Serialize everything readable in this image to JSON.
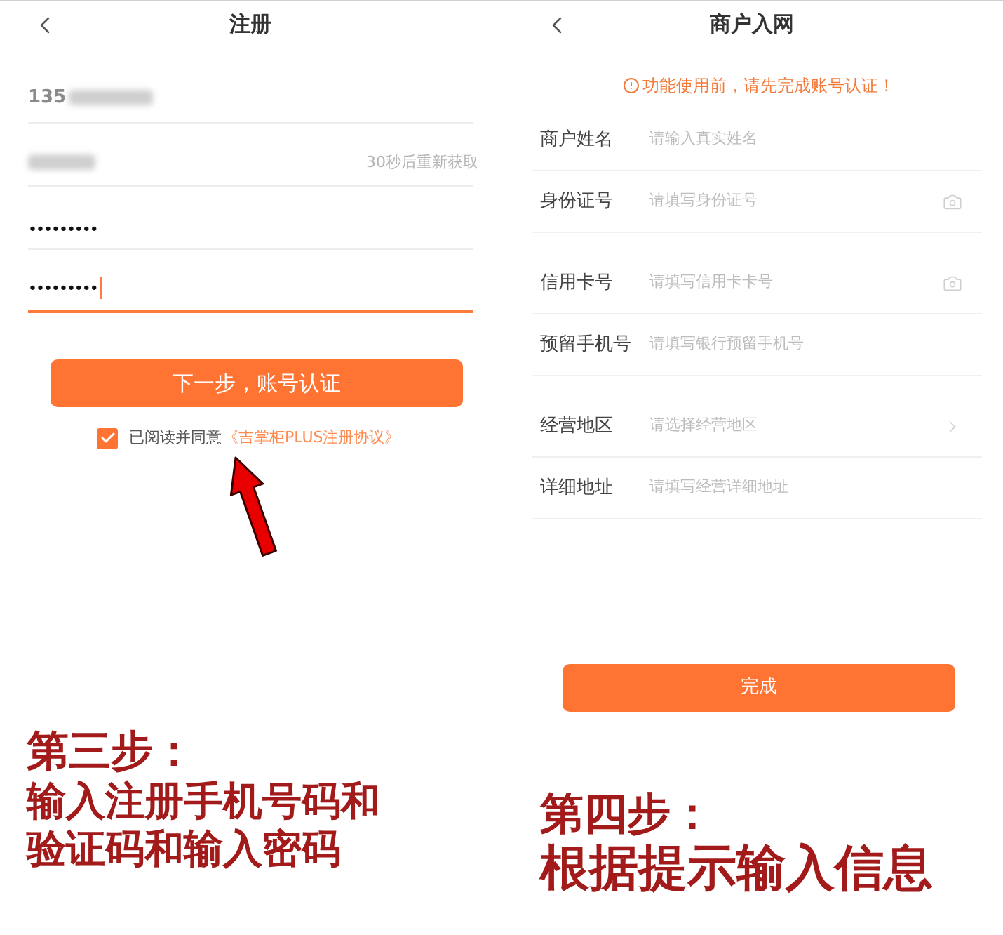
{
  "register_screen": {
    "title": "注册",
    "fields": [
      {
        "kind": "phone",
        "value": "135",
        "redacted": true,
        "focused": false
      },
      {
        "kind": "code",
        "action": "30秒后重新获取",
        "redacted": true,
        "focused": false
      },
      {
        "kind": "password",
        "value": "•••••••••",
        "redacted": false,
        "focused": false
      },
      {
        "kind": "password",
        "value": "•••••••••",
        "redacted": false,
        "focused": true
      }
    ],
    "next_button": "下一步，账号认证",
    "agreement": {
      "checked": true,
      "text": "已阅读并同意",
      "link": "《吉掌柜PLUS注册协议》"
    }
  },
  "merchant_screen": {
    "title": "商户入网",
    "notice": "功能使用前，请先完成账号认证！",
    "sections": [
      {
        "rows": [
          {
            "kind": "text",
            "label": "商户姓名",
            "placeholder": "请输入真实姓名"
          },
          {
            "kind": "camera",
            "label": "身份证号",
            "placeholder": "请填写身份证号"
          }
        ]
      },
      {
        "rows": [
          {
            "kind": "camera",
            "label": "信用卡号",
            "placeholder": "请填写信用卡卡号"
          },
          {
            "kind": "text",
            "label": "预留手机号",
            "placeholder": "请填写银行预留手机号"
          }
        ]
      },
      {
        "rows": [
          {
            "kind": "select",
            "label": "经营地区",
            "placeholder": "请选择经营地区"
          },
          {
            "kind": "text",
            "label": "详细地址",
            "placeholder": "请填写经营详细地址"
          }
        ]
      }
    ],
    "done_button": "完成"
  },
  "captions": [
    {
      "title": "第三步：",
      "lines": [
        "输入注册手机号码和",
        "验证码和输入密码"
      ]
    },
    {
      "title": "第四步：",
      "lines": [
        "根据提示输入信息"
      ]
    }
  ]
}
